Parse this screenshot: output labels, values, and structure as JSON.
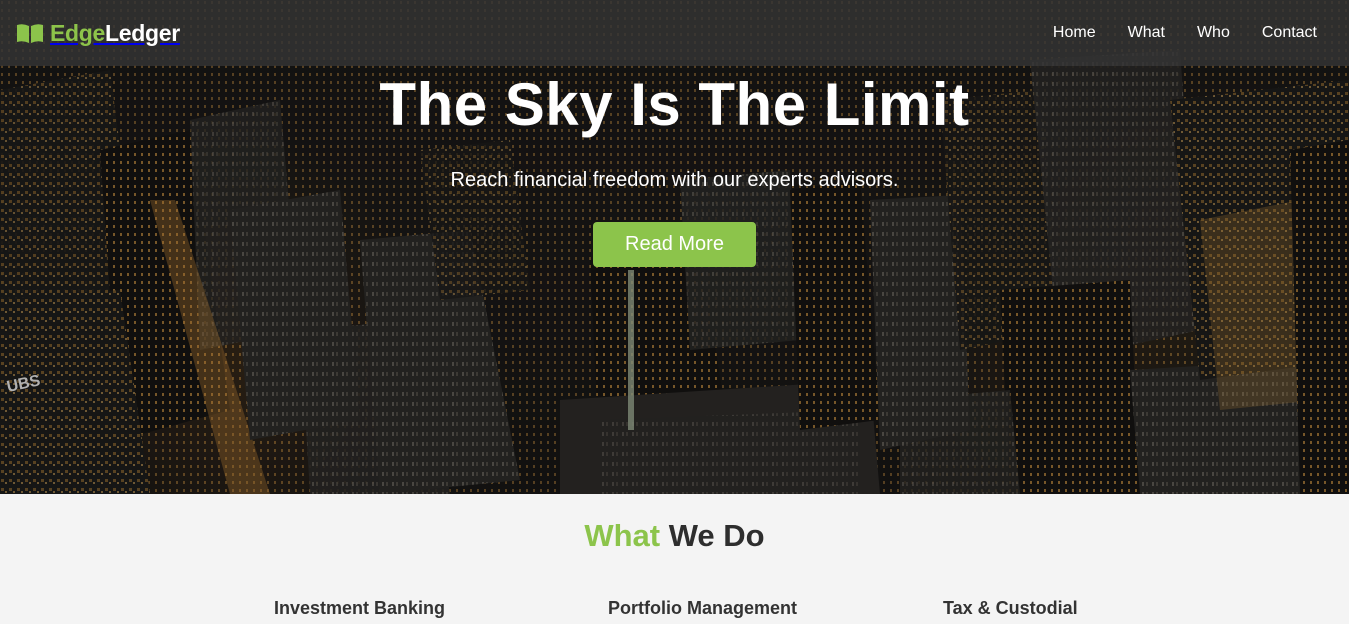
{
  "brand": {
    "name_part1": "Edge",
    "name_part2": "Ledger",
    "icon": "open-book-icon",
    "accent_color": "#8cc44b"
  },
  "nav": {
    "items": [
      {
        "label": "Home"
      },
      {
        "label": "What"
      },
      {
        "label": "Who"
      },
      {
        "label": "Contact"
      }
    ]
  },
  "hero": {
    "title": "The Sky Is The Limit",
    "subtitle": "Reach financial freedom with our experts advisors.",
    "cta_label": "Read More"
  },
  "what_we_do": {
    "title_accent": "What",
    "title_rest": " We Do",
    "services": [
      {
        "title": "Investment Banking"
      },
      {
        "title": "Portfolio Management"
      },
      {
        "title": "Tax & Custodial"
      }
    ]
  }
}
